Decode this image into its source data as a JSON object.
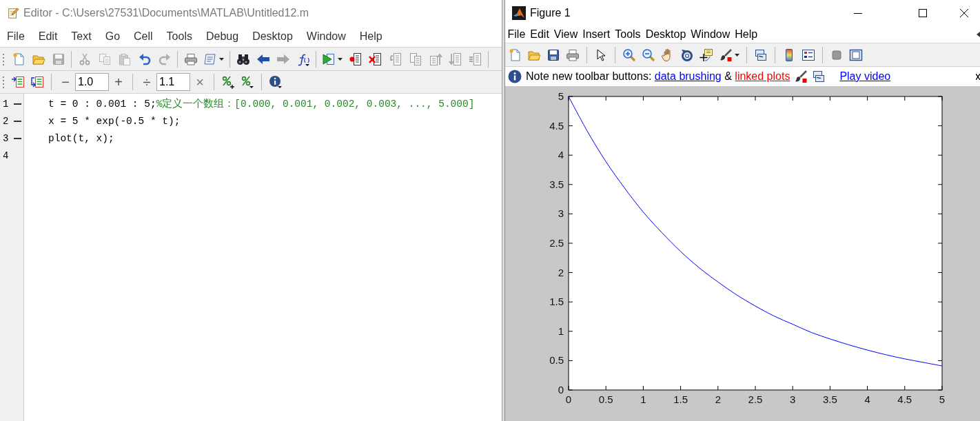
{
  "editor": {
    "title": "Editor - C:\\Users\\27531\\Documents\\MATLAB\\Untitled12.m",
    "menu": [
      {
        "label": "File"
      },
      {
        "label": "Edit"
      },
      {
        "label": "Text"
      },
      {
        "label": "Go"
      },
      {
        "label": "Cell"
      },
      {
        "label": "Tools"
      },
      {
        "label": "Debug"
      },
      {
        "label": "Desktop"
      },
      {
        "label": "Window"
      },
      {
        "label": "Help"
      }
    ],
    "toolbar": [
      {
        "buttons": [
          {
            "disabled": false
          },
          {
            "disabled": false
          },
          {
            "disabled": true
          }
        ]
      },
      {
        "buttons": [
          {
            "disabled": true
          },
          {
            "disabled": true
          },
          {
            "disabled": true
          },
          {
            "disabled": false
          },
          {
            "disabled": true
          }
        ]
      },
      {
        "buttons": [
          {
            "disabled": false
          },
          {
            "disabled": false
          }
        ]
      },
      {
        "buttons": [
          {
            "disabled": false
          },
          {
            "disabled": false
          },
          {
            "disabled": true
          },
          {
            "disabled": false
          }
        ]
      },
      {
        "buttons": [
          {
            "disabled": false
          },
          {
            "disabled": false
          },
          {
            "disabled": false
          },
          {
            "disabled": true
          },
          {
            "disabled": true
          },
          {
            "disabled": true
          },
          {
            "disabled": true
          },
          {
            "disabled": true
          }
        ]
      }
    ],
    "cell_toolbar": {
      "decrement": "−",
      "increment_value": "1.0",
      "increment": "+",
      "divide": "÷",
      "scale_value": "1.1",
      "multiply": "×"
    },
    "lines": [
      {
        "number": "1",
        "executable": true,
        "code": "t = 0 : 0.001 : 5;",
        "comment": "%定义一个数组：[0.000, 0.001, 0.002, 0.003, ..., 5.000]"
      },
      {
        "number": "2",
        "executable": true,
        "code": "x = 5 * exp(-0.5 * t);"
      },
      {
        "number": "3",
        "executable": true,
        "code": "plot(t, x);"
      },
      {
        "number": "4",
        "executable": false
      }
    ]
  },
  "figure": {
    "title": "Figure 1",
    "menu": [
      {
        "label": "File"
      },
      {
        "label": "Edit"
      },
      {
        "label": "View"
      },
      {
        "label": "Insert"
      },
      {
        "label": "Tools"
      },
      {
        "label": "Desktop"
      },
      {
        "label": "Window"
      },
      {
        "label": "Help"
      }
    ],
    "info_bar": {
      "message": [
        {
          "kind": "text",
          "text": "Note new toolbar buttons:"
        },
        {
          "kind": "link",
          "text": "data brushing",
          "color": "#0000ff"
        },
        {
          "kind": "text",
          "text": "&"
        },
        {
          "kind": "link",
          "text": "linked plots",
          "color": "#ff0000"
        }
      ],
      "video_link": "Play video"
    },
    "chart_data": {
      "type": "line",
      "x": [
        0,
        0.25,
        0.5,
        0.75,
        1,
        1.25,
        1.5,
        1.75,
        2,
        2.25,
        2.5,
        2.75,
        3,
        3.25,
        3.5,
        3.75,
        4,
        4.25,
        4.5,
        4.75,
        5
      ],
      "series": [
        {
          "color": "#0000ff",
          "values": [
            5,
            4.41,
            3.89,
            3.44,
            3.03,
            2.68,
            2.36,
            2.08,
            1.84,
            1.62,
            1.43,
            1.26,
            1.12,
            0.98,
            0.87,
            0.77,
            0.68,
            0.6,
            0.53,
            0.47,
            0.41
          ]
        }
      ],
      "xlim": [
        0,
        5
      ],
      "ylim": [
        0,
        5
      ],
      "xticks": [
        0,
        0.5,
        1,
        1.5,
        2,
        2.5,
        3,
        3.5,
        4,
        4.5,
        5
      ],
      "yticks": [
        0,
        0.5,
        1,
        1.5,
        2,
        2.5,
        3,
        3.5,
        4,
        4.5,
        5
      ]
    }
  }
}
